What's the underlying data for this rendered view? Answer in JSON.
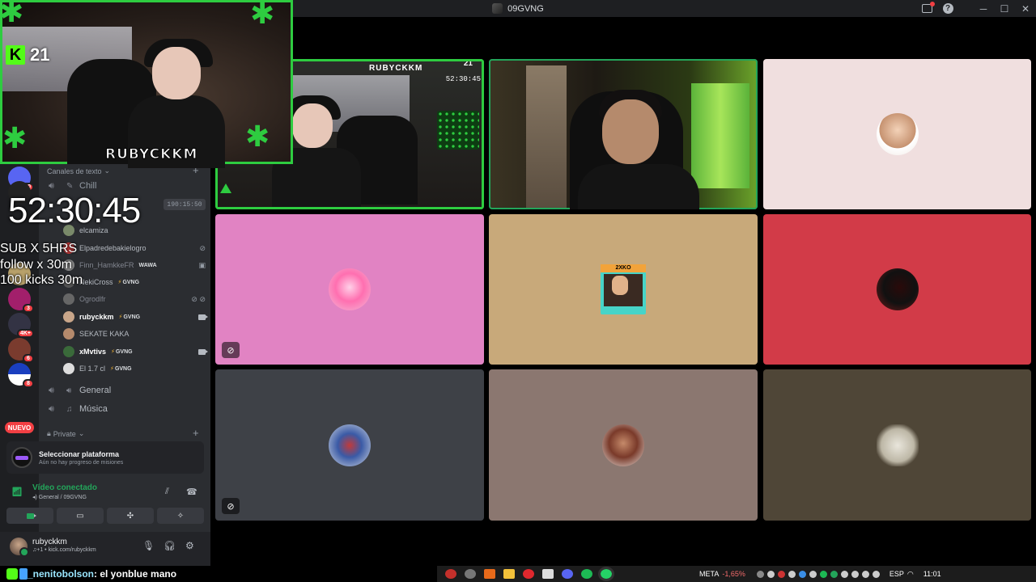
{
  "window": {
    "title": "09GVNG"
  },
  "rail": {
    "badges": [
      "30",
      "3",
      "4K+",
      "6",
      "8"
    ],
    "new_label": "NUEVO"
  },
  "sidebar": {
    "text_category": "Canales de texto",
    "channels": [
      {
        "name": "Chill",
        "active_time": "190:15:50"
      },
      {
        "name": "General"
      },
      {
        "name": "Música"
      }
    ],
    "private_category": "Private",
    "voice_users": [
      {
        "name": "elcamiza"
      },
      {
        "name": "Elpadredebakielogro"
      },
      {
        "name": "Finn_HamkkeFR",
        "tag": "WAWA"
      },
      {
        "name": "NekiCross",
        "tag": "GVNG"
      },
      {
        "name": "Ogrodlfr"
      },
      {
        "name": "rubyckkm",
        "tag": "GVNG"
      },
      {
        "name": "SEKATE KAKA"
      },
      {
        "name": "xMvtivs",
        "tag": "GVNG"
      },
      {
        "name": "El 1.7 cl",
        "tag": "GVNG"
      }
    ]
  },
  "quest": {
    "title": "Seleccionar plataforma",
    "subtitle": "Aún no hay progreso de misiones"
  },
  "voice": {
    "status": "Vídeo conectado",
    "location": "General / 09GVNG"
  },
  "user": {
    "name": "rubyckkm",
    "status": "kick.com/rubyckkm"
  },
  "overlay": {
    "kick_count": "21",
    "streamer_name": "RUBYCKKM",
    "timer": "52:30:45",
    "sub_lines": [
      "SUB X 5HRS",
      "follow x 30m",
      "100 kicks 30m"
    ],
    "mini_timer": "52:30:45",
    "mini_count": "21"
  },
  "grid": {
    "tiles": [
      {
        "type": "stream",
        "bg": "#1d1a18"
      },
      {
        "type": "camera",
        "bg": "#1e1a14"
      },
      {
        "type": "avatar",
        "bg": "#f0dfdf"
      },
      {
        "type": "avatar",
        "bg": "#e183c3",
        "muted": true
      },
      {
        "type": "avatar",
        "bg": "#c8a97a",
        "avatar_label": "2XKO"
      },
      {
        "type": "avatar",
        "bg": "#d23b48"
      },
      {
        "type": "avatar",
        "bg": "#3e4147",
        "muted": true
      },
      {
        "type": "avatar",
        "bg": "#8b7770"
      },
      {
        "type": "avatar",
        "bg": "#4f4637"
      }
    ]
  },
  "chat": {
    "username": "_nenitobolson",
    "message": "el yonblue mano"
  },
  "taskbar": {
    "ticker": "META",
    "change": "-1,65%",
    "lang": "ESP",
    "time": "11:01"
  },
  "colors": {
    "accent_green": "#2ecc40",
    "speaking": "#23a55a",
    "kick_green": "#53fc18"
  }
}
